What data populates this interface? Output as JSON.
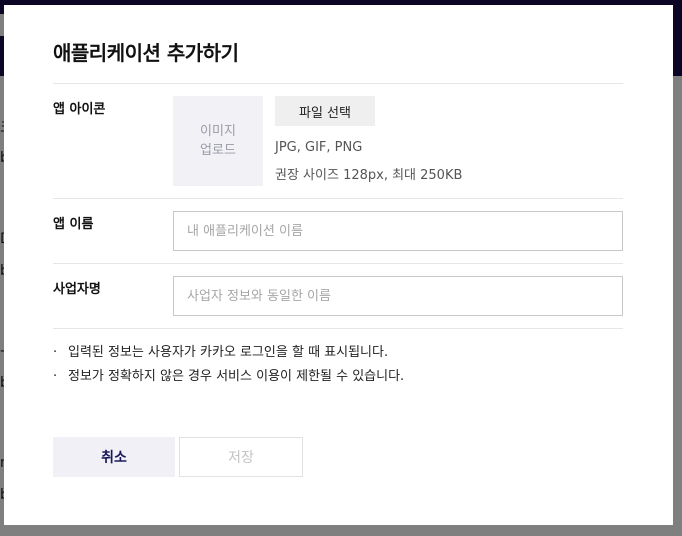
{
  "modal": {
    "title": "애플리케이션 추가하기"
  },
  "form": {
    "icon": {
      "label": "앱 아이콘",
      "upload_line1": "이미지",
      "upload_line2": "업로드",
      "file_button": "파일 선택",
      "formats": "JPG, GIF, PNG",
      "recommend": "권장 사이즈 128px, 최대 250KB"
    },
    "app_name": {
      "label": "앱 이름",
      "value": "",
      "placeholder": "내 애플리케이션 이름"
    },
    "company": {
      "label": "사업자명",
      "value": "",
      "placeholder": "사업자 정보와 동일한 이름"
    }
  },
  "notes": [
    "입력된 정보는 사용자가 카카오 로그인을 할 때 표시됩니다.",
    "정보가 정확하지 않은 경우 서비스 이용이 제한될 수 있습니다."
  ],
  "note_bullet": "·",
  "buttons": {
    "cancel": "취소",
    "save": "저장"
  },
  "background_fragments": [
    "크",
    "b",
    "D",
    "b",
    "-",
    "b",
    "n",
    "b"
  ],
  "colors": {
    "topbar": "#1a0a4d",
    "cancel_text": "#1a1a5a",
    "cancel_bg": "#f0f0f6"
  }
}
